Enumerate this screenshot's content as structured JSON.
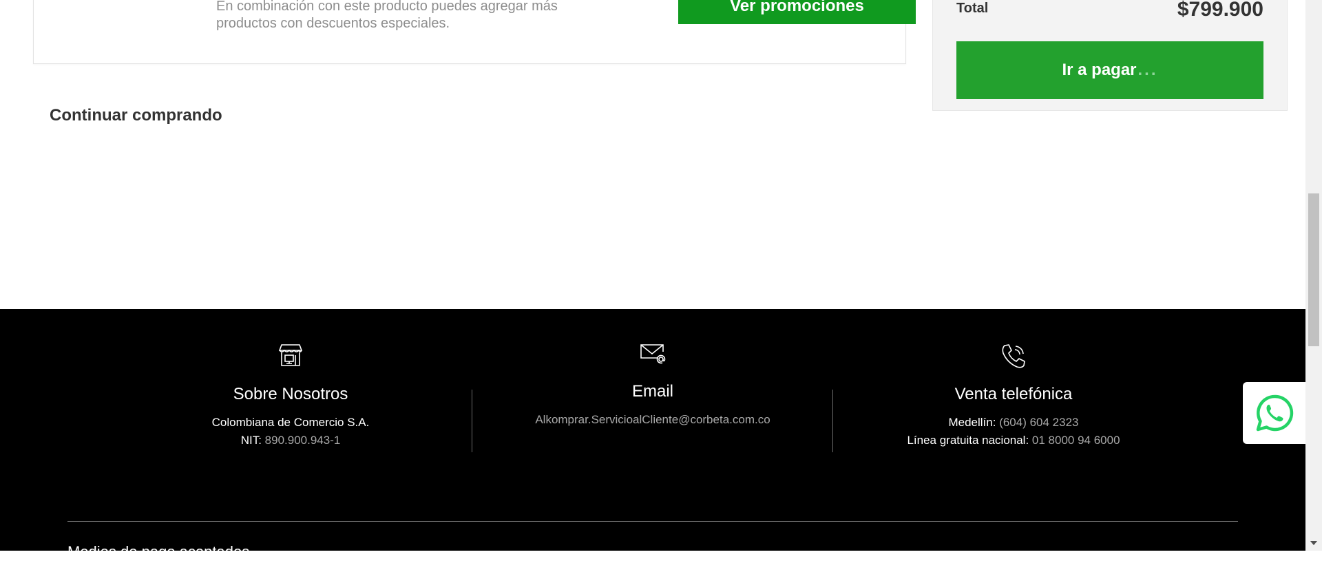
{
  "promo": {
    "description": "En combinación con este producto puedes agregar más productos con descuentos especiales.",
    "button_label": "Ver promociones"
  },
  "continue_label": "Continuar comprando",
  "summary": {
    "total_label": "Total",
    "total_value": "$799.900",
    "pay_label": "Ir a pagar",
    "pay_dots": "..."
  },
  "footer": {
    "about": {
      "title": "Sobre Nosotros",
      "company": "Colombiana de Comercio S.A.",
      "nit_label": "NIT:",
      "nit_value": "890.900.943-1",
      "icon": "store-icon"
    },
    "email": {
      "title": "Email",
      "address": "Alkomprar.ServicioalCliente@corbeta.com.co",
      "icon": "email-icon"
    },
    "phone": {
      "title": "Venta telefónica",
      "medellin_label": "Medellín:",
      "medellin_value": "(604) 604 2323",
      "national_label": "Línea gratuita nacional:",
      "national_value": "01 8000 94 6000",
      "icon": "phone-icon"
    },
    "next_section": "Medios de pago aceptados"
  },
  "colors": {
    "promo_button": "#109a1f",
    "pay_button": "#23a12e",
    "footer_bg": "#000000",
    "whatsapp": "#25d366"
  }
}
